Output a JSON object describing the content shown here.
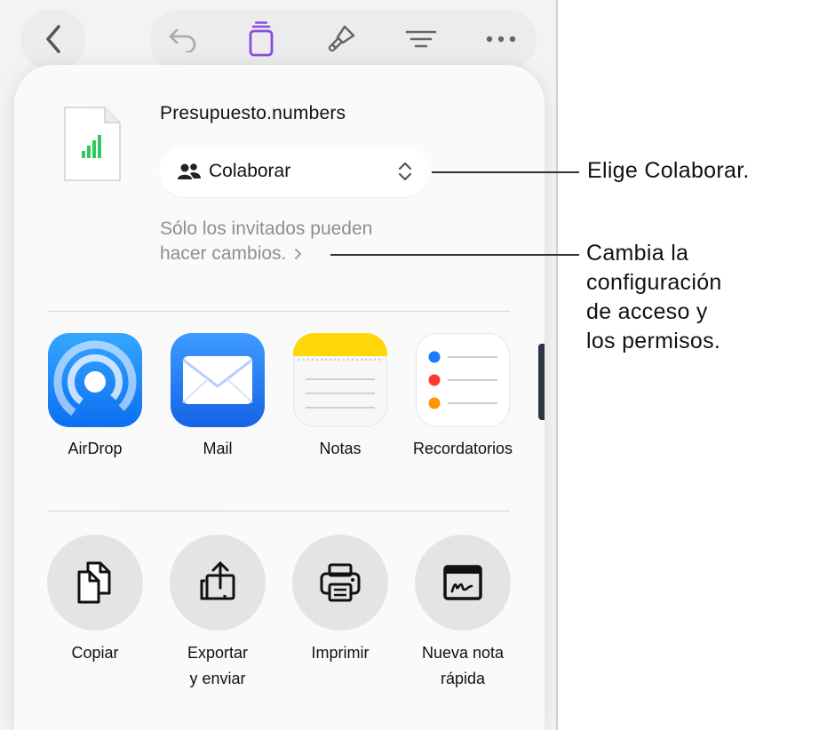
{
  "document": {
    "file_name": "Presupuesto.numbers"
  },
  "collaboration": {
    "mode_label": "Colaborar",
    "access_summary_line1": "Sólo los invitados pueden",
    "access_summary_line2": "hacer cambios."
  },
  "share_apps": [
    {
      "label": "AirDrop",
      "icon": "airdrop-icon"
    },
    {
      "label": "Mail",
      "icon": "mail-icon"
    },
    {
      "label": "Notas",
      "icon": "notes-icon"
    },
    {
      "label": "Recordatorios",
      "icon": "reminders-icon"
    }
  ],
  "actions": [
    {
      "label_line1": "Copiar",
      "label_line2": "",
      "icon": "copy-icon"
    },
    {
      "label_line1": "Exportar",
      "label_line2": "y enviar",
      "icon": "export-icon"
    },
    {
      "label_line1": "Imprimir",
      "label_line2": "",
      "icon": "print-icon"
    },
    {
      "label_line1": "Nueva nota",
      "label_line2": "rápida",
      "icon": "quick-note-icon"
    }
  ],
  "toolbar_icons": [
    "back-icon",
    "undo-icon",
    "collaborate-icon",
    "format-brush-icon",
    "organize-icon",
    "more-icon"
  ],
  "callouts": {
    "choose_collaborate": "Elige Colaborar.",
    "change_access_line1": "Cambia la",
    "change_access_line2": "configuración",
    "change_access_line3": "de acceso y",
    "change_access_line4": "los permisos."
  },
  "colors": {
    "accent_purple": "#8a4fd8",
    "airdrop_blue": "#1a8cff",
    "mail_blue": "#2e7cf6",
    "notes_yellow": "#ffd60a",
    "numbers_green": "#34c759"
  }
}
